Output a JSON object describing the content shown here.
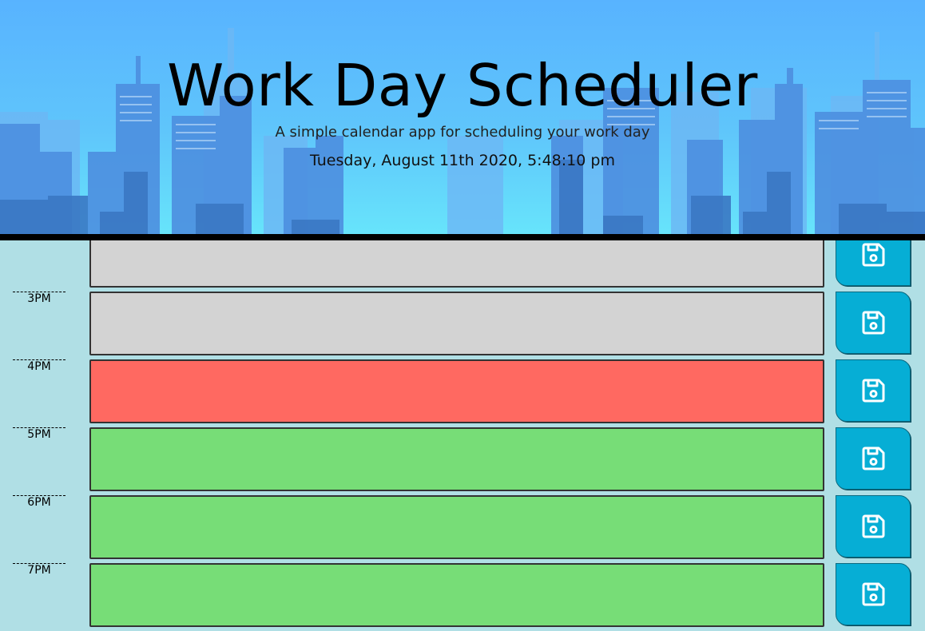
{
  "header": {
    "title": "Work Day Scheduler",
    "lead": "A simple calendar app for scheduling your work day",
    "current_day": "Tuesday, August 11th 2020, 5:48:10 pm"
  },
  "colors": {
    "past": "#d3d3d3",
    "present": "#ff6961",
    "future": "#77dd77",
    "save_button": "#06aed5"
  },
  "timeblocks": [
    {
      "hour": "",
      "status": "past",
      "text": ""
    },
    {
      "hour": "3PM",
      "status": "past",
      "text": ""
    },
    {
      "hour": "4PM",
      "status": "present",
      "text": ""
    },
    {
      "hour": "5PM",
      "status": "future",
      "text": ""
    },
    {
      "hour": "6PM",
      "status": "future",
      "text": ""
    },
    {
      "hour": "7PM",
      "status": "future",
      "text": ""
    }
  ],
  "icons": {
    "save": "save-icon"
  }
}
